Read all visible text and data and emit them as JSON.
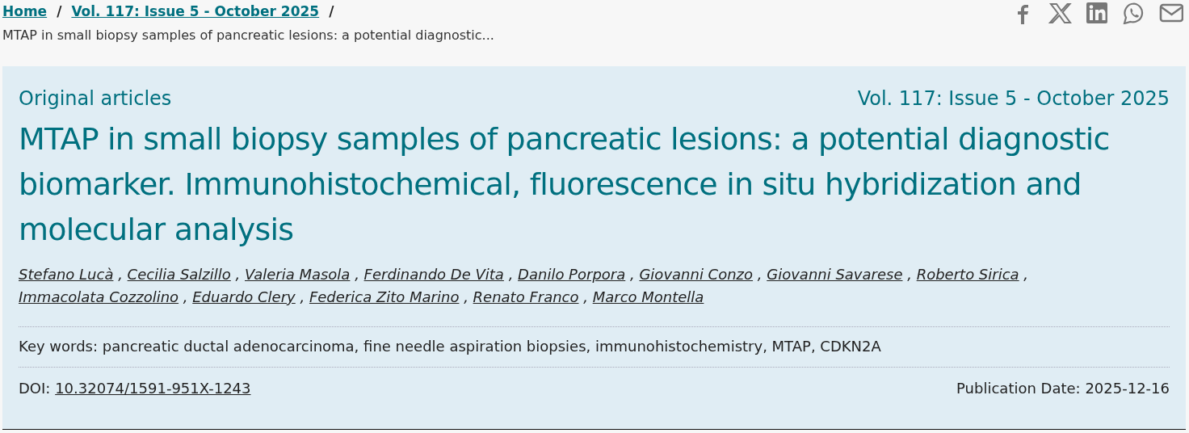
{
  "breadcrumb": {
    "items": [
      {
        "label": "Home",
        "separator": "/"
      },
      {
        "label": "Vol. 117: Issue 5 - October 2025",
        "separator": "/"
      }
    ],
    "current": "MTAP in small biopsy samples of pancreatic lesions: a potential diagnostic..."
  },
  "share_icons": [
    {
      "kind": "facebook"
    },
    {
      "kind": "x"
    },
    {
      "kind": "linkedin"
    },
    {
      "kind": "whatsapp"
    },
    {
      "kind": "mail"
    }
  ],
  "article": {
    "section": "Original articles",
    "issue": "Vol. 117: Issue 5 - October 2025",
    "title": "MTAP in small biopsy samples of pancreatic lesions: a potential diagnostic biomarker. Immunohistochemical, fluorescence in situ hybridization and molecular analysis",
    "author_separator": ",",
    "authors": [
      "Stefano Lucà",
      "Cecilia Salzillo",
      "Valeria Masola",
      "Ferdinando De Vita",
      "Danilo Porpora",
      "Giovanni Conzo",
      "Giovanni Savarese",
      "Roberto Sirica",
      "Immacolata Cozzolino",
      "Eduardo Clery",
      "Federica Zito Marino",
      "Renato Franco",
      "Marco Montella"
    ],
    "keywords": "Key words: pancreatic ductal adenocarcinoma, fine needle aspiration biopsies, immunohistochemistry, MTAP, CDKN2A",
    "doi_label": "DOI:",
    "doi": "10.32074/1591-951X-1243",
    "publication_date": "Publication Date: 2025-12-16"
  }
}
